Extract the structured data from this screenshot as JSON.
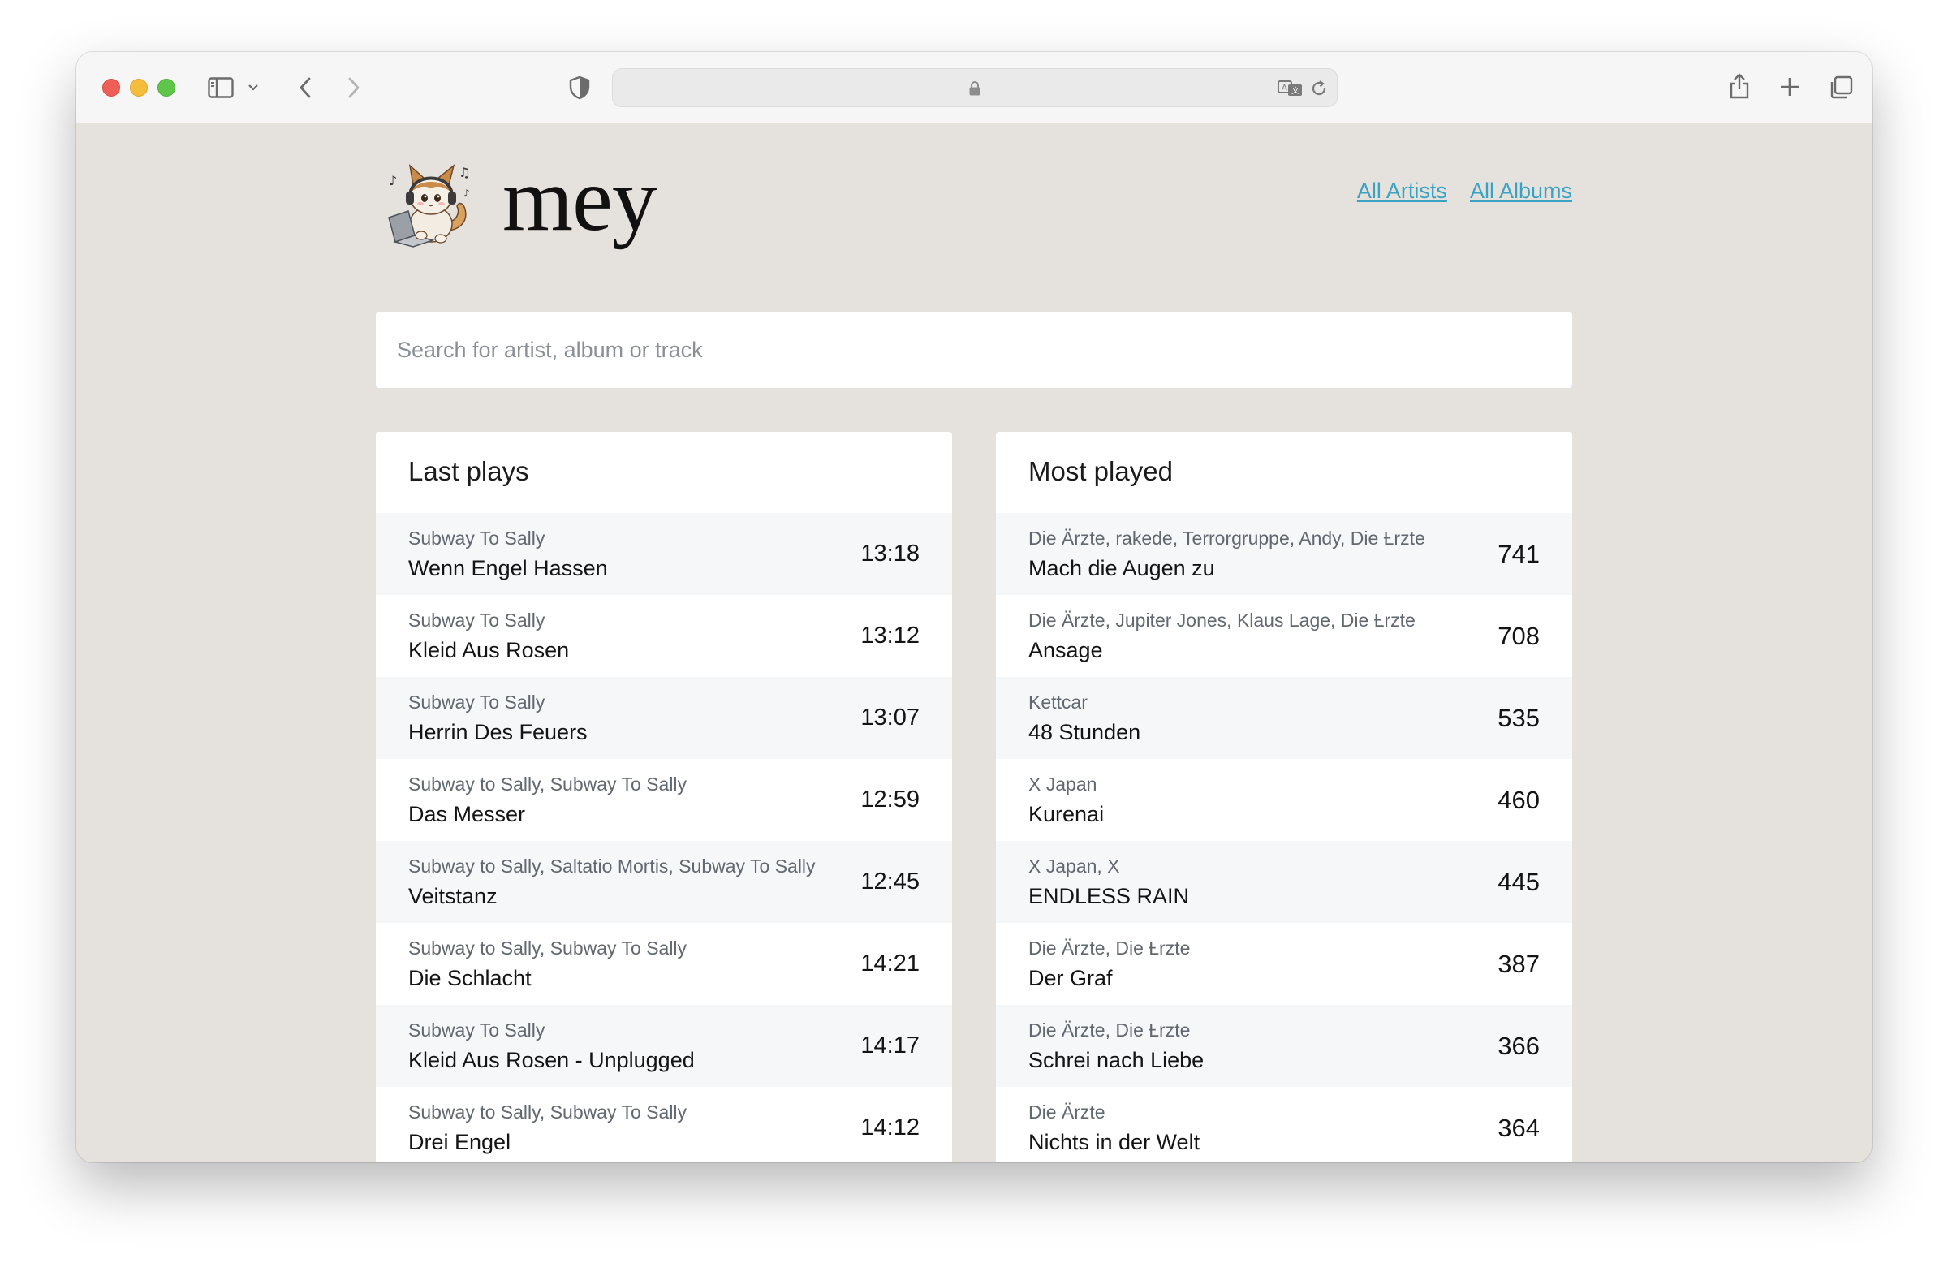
{
  "app": {
    "title": "mey",
    "nav": [
      "All Artists",
      "All Albums"
    ]
  },
  "search": {
    "placeholder": "Search for artist, album or track",
    "value": ""
  },
  "last_plays": {
    "title": "Last plays",
    "rows": [
      {
        "artist": "Subway To Sally",
        "track": "Wenn Engel Hassen",
        "time": "13:18"
      },
      {
        "artist": "Subway To Sally",
        "track": "Kleid Aus Rosen",
        "time": "13:12"
      },
      {
        "artist": "Subway To Sally",
        "track": "Herrin Des Feuers",
        "time": "13:07"
      },
      {
        "artist": "Subway to Sally, Subway To Sally",
        "track": "Das Messer",
        "time": "12:59"
      },
      {
        "artist": "Subway to Sally, Saltatio Mortis, Subway To Sally",
        "track": "Veitstanz",
        "time": "12:45"
      },
      {
        "artist": "Subway to Sally, Subway To Sally",
        "track": "Die Schlacht",
        "time": "14:21"
      },
      {
        "artist": "Subway To Sally",
        "track": "Kleid Aus Rosen - Unplugged",
        "time": "14:17"
      },
      {
        "artist": "Subway to Sally, Subway To Sally",
        "track": "Drei Engel",
        "time": "14:12"
      }
    ]
  },
  "most_played": {
    "title": "Most played",
    "rows": [
      {
        "artist": "Die Ärzte, rakede, Terrorgruppe, Andy, Die Ƚrzte",
        "track": "Mach die Augen zu",
        "count": "741"
      },
      {
        "artist": "Die Ärzte, Jupiter Jones, Klaus Lage, Die Ƚrzte",
        "track": "Ansage",
        "count": "708"
      },
      {
        "artist": "Kettcar",
        "track": "48 Stunden",
        "count": "535"
      },
      {
        "artist": "X Japan",
        "track": "Kurenai",
        "count": "460"
      },
      {
        "artist": "X Japan, X",
        "track": "ENDLESS RAIN",
        "count": "445"
      },
      {
        "artist": "Die Ärzte, Die Ƚrzte",
        "track": "Der Graf",
        "count": "387"
      },
      {
        "artist": "Die Ärzte, Die Ƚrzte",
        "track": "Schrei nach Liebe",
        "count": "366"
      },
      {
        "artist": "Die Ärzte",
        "track": "Nichts in der Welt",
        "count": "364"
      }
    ]
  },
  "icons": {
    "traffic_lights": [
      "close",
      "minimize",
      "zoom"
    ],
    "toolbar": [
      "sidebar-icon",
      "chevron-down-icon",
      "back-icon",
      "forward-icon",
      "shield-icon",
      "lock-icon",
      "translate-icon",
      "reload-icon",
      "share-icon",
      "plus-icon",
      "tabs-icon"
    ]
  },
  "colors": {
    "page_background": "#e5e1dc",
    "link": "#3aa3c3",
    "row_alt": "#f6f7f9"
  }
}
